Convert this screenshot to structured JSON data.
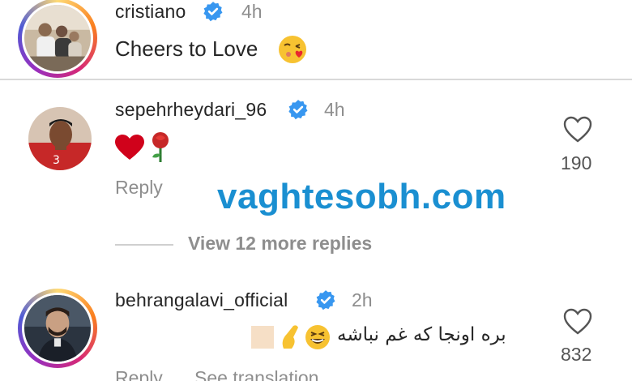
{
  "post": {
    "username": "cristiano",
    "time": "4h",
    "caption": "Cheers to Love",
    "caption_emoji": "kissing-face-icon"
  },
  "comments": [
    {
      "username": "sepehrheydari_96",
      "time": "4h",
      "text_emoji": [
        "red-heart-icon",
        "rose-icon"
      ],
      "reply_label": "Reply",
      "likes": "190",
      "view_more": "View 12 more replies"
    },
    {
      "username": "behrangalavi_official",
      "time": "2h",
      "text": "بره اونجا که غم نباشه",
      "reply_label": "Reply",
      "see_translation": "See translation",
      "likes": "832"
    }
  ],
  "watermark": "vaghtesobh.com",
  "colors": {
    "verified_blue": "#3897f0",
    "watermark_blue": "#1a8fd1",
    "secondary_text": "#8e8e8e"
  }
}
